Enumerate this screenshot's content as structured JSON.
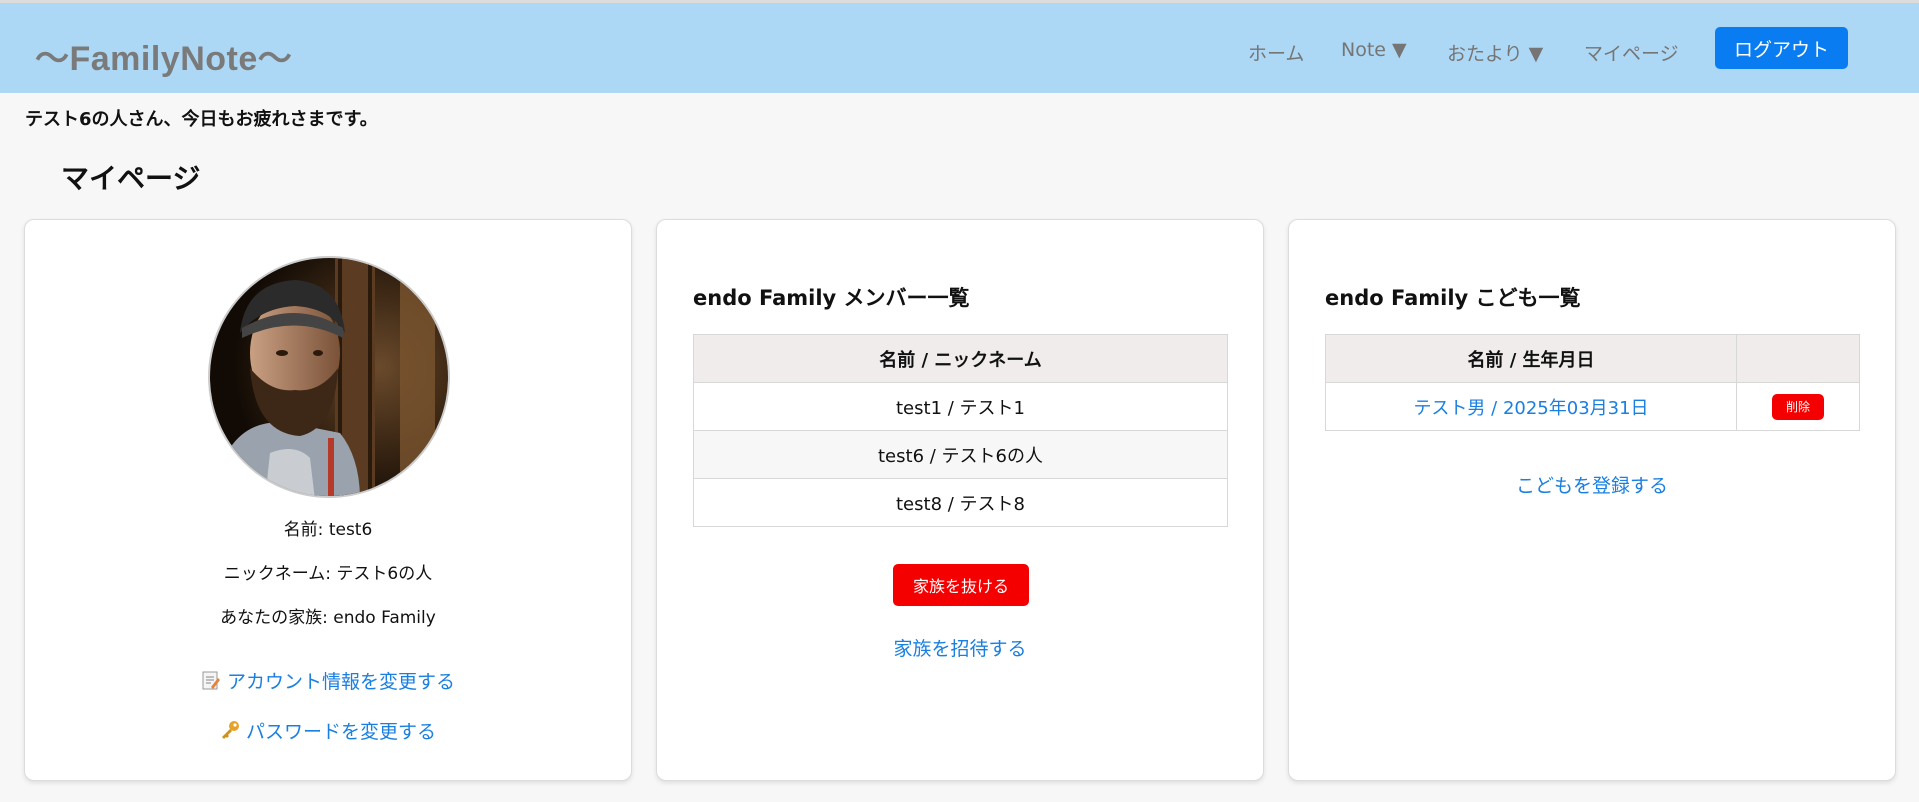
{
  "header": {
    "logo": "〜FamilyNote〜",
    "nav": {
      "home": "ホーム",
      "note": "Note ▼",
      "letters": "おたより ▼",
      "mypage": "マイページ",
      "logout": "ログアウト"
    }
  },
  "greeting": "テスト6の人さん、今日もお疲れさまです。",
  "page_title": "マイページ",
  "profile": {
    "name": "名前: test6",
    "nickname": "ニックネーム: テスト6の人",
    "family": "あなたの家族: endo Family",
    "edit_account": "アカウント情報を変更する",
    "change_password": "パスワードを変更する",
    "edit_icon": "memo-icon",
    "password_icon": "key-icon"
  },
  "members": {
    "title": "endo Family メンバー一覧",
    "header": "名前 / ニックネーム",
    "rows": [
      "test1 / テスト1",
      "test6 / テスト6の人",
      "test8 / テスト8"
    ],
    "leave_button": "家族を抜ける",
    "invite_link": "家族を招待する"
  },
  "children": {
    "title": "endo Family こども一覧",
    "header": "名前 / 生年月日",
    "rows": [
      {
        "label": "テスト男 / 2025年03月31日",
        "delete": "削除"
      }
    ],
    "register_link": "こどもを登録する"
  },
  "colors": {
    "header_bg": "#add8f5",
    "primary": "#0a7cf2",
    "link": "#1a7fe0",
    "danger": "#f40000"
  }
}
